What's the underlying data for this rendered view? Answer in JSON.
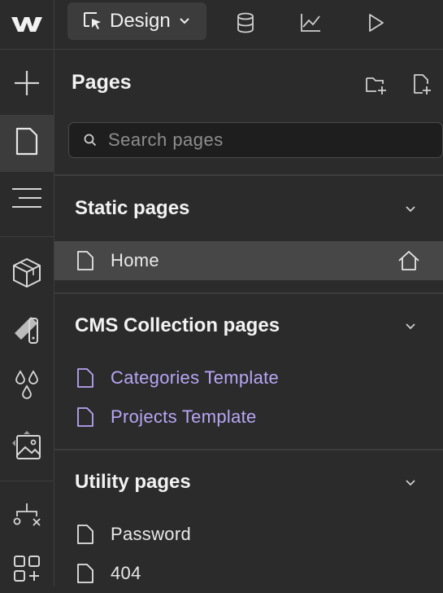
{
  "topbar": {
    "logo_icon": "webflow-logo-icon",
    "mode_button_label": "Design",
    "icons": [
      "database-icon",
      "analytics-chart-icon",
      "play-preview-icon"
    ]
  },
  "rail": {
    "items": [
      {
        "name": "add-elements",
        "icon": "plus-icon"
      },
      {
        "name": "pages",
        "icon": "page-icon",
        "active": true
      },
      {
        "name": "navigator",
        "icon": "navigator-lines-icon"
      },
      {
        "name": "components",
        "icon": "cube-icon"
      },
      {
        "name": "style-selectors",
        "icon": "paint-brush-icon"
      },
      {
        "name": "variables",
        "icon": "droplets-icon"
      },
      {
        "name": "assets",
        "icon": "image-icon"
      },
      {
        "name": "logic",
        "icon": "flow-branch-icon"
      },
      {
        "name": "apps",
        "icon": "apps-grid-icon"
      }
    ]
  },
  "panel": {
    "title": "Pages",
    "search_placeholder": "Search pages",
    "sections": [
      {
        "title": "Static pages",
        "pages": [
          {
            "label": "Home",
            "home": true,
            "selected": true
          }
        ]
      },
      {
        "title": "CMS Collection pages",
        "pages": [
          {
            "label": "Categories Template"
          },
          {
            "label": "Projects Template"
          }
        ]
      },
      {
        "title": "Utility pages",
        "pages": [
          {
            "label": "Password"
          },
          {
            "label": "404"
          }
        ]
      }
    ]
  },
  "colors": {
    "background": "#2b2b2b",
    "selected_row": "#474747",
    "cms_accent": "#b8a6f5"
  }
}
